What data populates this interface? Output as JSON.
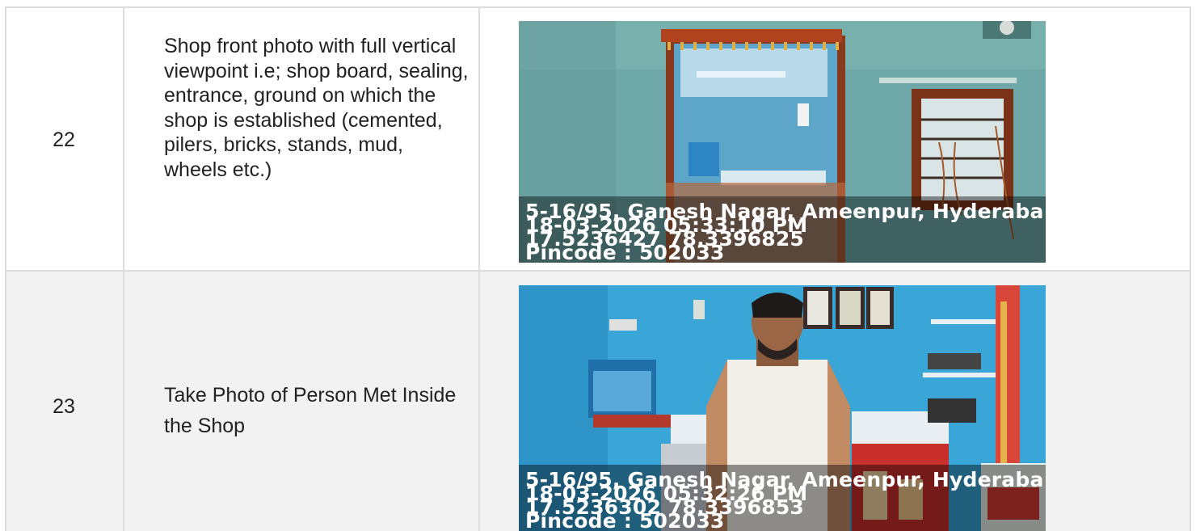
{
  "rows": [
    {
      "number": "22",
      "description": "Shop front photo with full vertical viewpoint i.e; shop board, sealing, entrance, ground on which the shop is established (cemented, pilers, bricks, stands, mud, wheels etc.)",
      "photo": {
        "address": "5-16/95, Ganesh Nagar, Ameenpur, Hyderaba",
        "datetime": "18-03-2026 05:33:10 PM",
        "coordinates": "17.5236427 78.3396825",
        "pincode": "Pincode : 502033"
      }
    },
    {
      "number": "23",
      "description": "Take Photo of Person Met Inside the Shop",
      "photo": {
        "address": "5-16/95, Ganesh Nagar, Ameenpur, Hyderaba",
        "datetime": "18-03-2026 05:32:26 PM",
        "coordinates": "17.5236302 78.3396853",
        "pincode": "Pincode : 502033"
      }
    }
  ],
  "colors": {
    "border": "#dcdcdc",
    "row_alt_background": "#f2f2f2",
    "wall_teal": "#6fa8a8",
    "wall_blue": "#3aa6d8"
  }
}
